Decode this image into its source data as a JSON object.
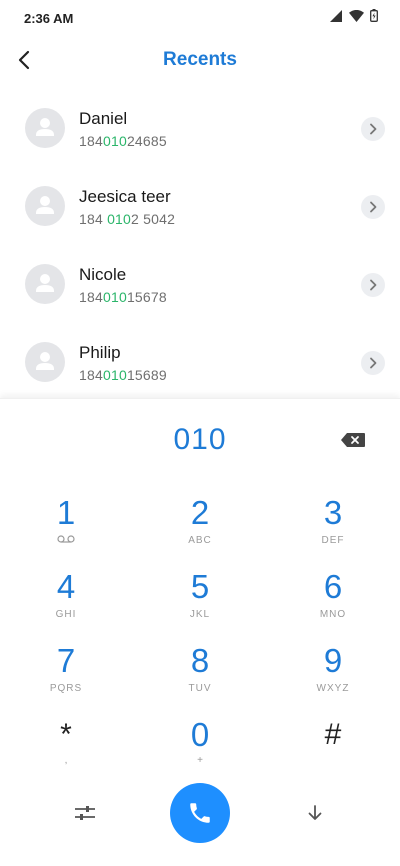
{
  "status_bar": {
    "time": "2:36 AM"
  },
  "header": {
    "title": "Recents"
  },
  "contacts": [
    {
      "name": "Daniel",
      "number_pre": "184",
      "number_match": "010",
      "number_post": "24685"
    },
    {
      "name": "Jeesica teer",
      "number_pre": "184 ",
      "number_match": "010",
      "number_post": "2 5042"
    },
    {
      "name": "Nicole",
      "number_pre": "184",
      "number_match": "010",
      "number_post": "15678"
    },
    {
      "name": "Philip",
      "number_pre": "184",
      "number_match": "010",
      "number_post": "15689"
    }
  ],
  "dialer": {
    "entered": "010",
    "keys": [
      {
        "digit": "1",
        "letters": ""
      },
      {
        "digit": "2",
        "letters": "ABC"
      },
      {
        "digit": "3",
        "letters": "DEF"
      },
      {
        "digit": "4",
        "letters": "GHI"
      },
      {
        "digit": "5",
        "letters": "JKL"
      },
      {
        "digit": "6",
        "letters": "MNO"
      },
      {
        "digit": "7",
        "letters": "PQRS"
      },
      {
        "digit": "8",
        "letters": "TUV"
      },
      {
        "digit": "9",
        "letters": "WXYZ"
      },
      {
        "digit": "*",
        "letters": ","
      },
      {
        "digit": "0",
        "letters": "+"
      },
      {
        "digit": "#",
        "letters": ""
      }
    ]
  },
  "icons": {
    "back": "back-arrow-icon",
    "backspace": "backspace-icon",
    "voicemail": "voicemail-icon",
    "settings": "settings-sliders-icon",
    "call": "phone-icon",
    "collapse": "arrow-down-icon"
  },
  "colors": {
    "accent": "#1e7bd6",
    "call_button": "#1e8fff",
    "match_highlight": "#2bb56a"
  }
}
